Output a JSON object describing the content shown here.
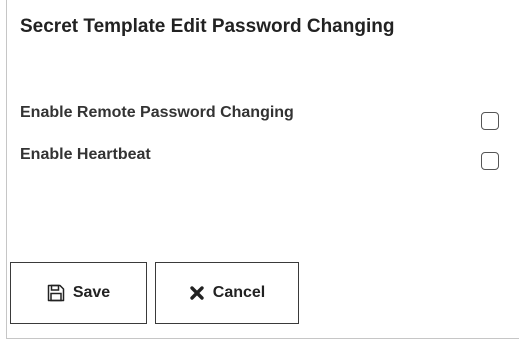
{
  "page": {
    "title": "Secret Template Edit Password Changing"
  },
  "settings": [
    {
      "label": "Enable Remote Password Changing",
      "checked": false
    },
    {
      "label": "Enable Heartbeat",
      "checked": false
    }
  ],
  "actions": {
    "save_label": "Save",
    "save_icon": "save-icon",
    "cancel_label": "Cancel",
    "cancel_icon": "close-icon"
  },
  "colors": {
    "text": "#222222",
    "border": "#3a3a3a",
    "panel_border": "#c6c6c6"
  }
}
